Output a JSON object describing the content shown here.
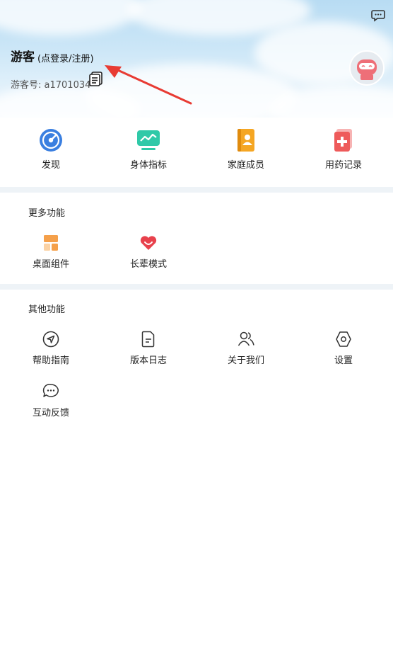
{
  "header": {
    "user_name": "游客",
    "login_link": "(点登录/注册)",
    "guest_id": "游客号: a1701034"
  },
  "quick_nav": [
    {
      "label": "发现",
      "icon": "compass-icon"
    },
    {
      "label": "身体指标",
      "icon": "monitor-chart-icon"
    },
    {
      "label": "家庭成员",
      "icon": "contacts-book-icon"
    },
    {
      "label": "用药记录",
      "icon": "medical-record-icon"
    }
  ],
  "more_features": {
    "title": "更多功能",
    "items": [
      {
        "label": "桌面组件",
        "icon": "widget-grid-icon"
      },
      {
        "label": "长辈模式",
        "icon": "heart-smile-icon"
      }
    ]
  },
  "other_features": {
    "title": "其他功能",
    "items": [
      {
        "label": "帮助指南",
        "icon": "navigation-circle-icon"
      },
      {
        "label": "版本日志",
        "icon": "document-icon"
      },
      {
        "label": "关于我们",
        "icon": "users-icon"
      },
      {
        "label": "设置",
        "icon": "hexagon-settings-icon"
      },
      {
        "label": "互动反馈",
        "icon": "chat-bubble-icon"
      }
    ]
  },
  "colors": {
    "accent_red": "#e83b33",
    "divider": "#eef3f7",
    "header_sky": "#b8dcf3"
  }
}
